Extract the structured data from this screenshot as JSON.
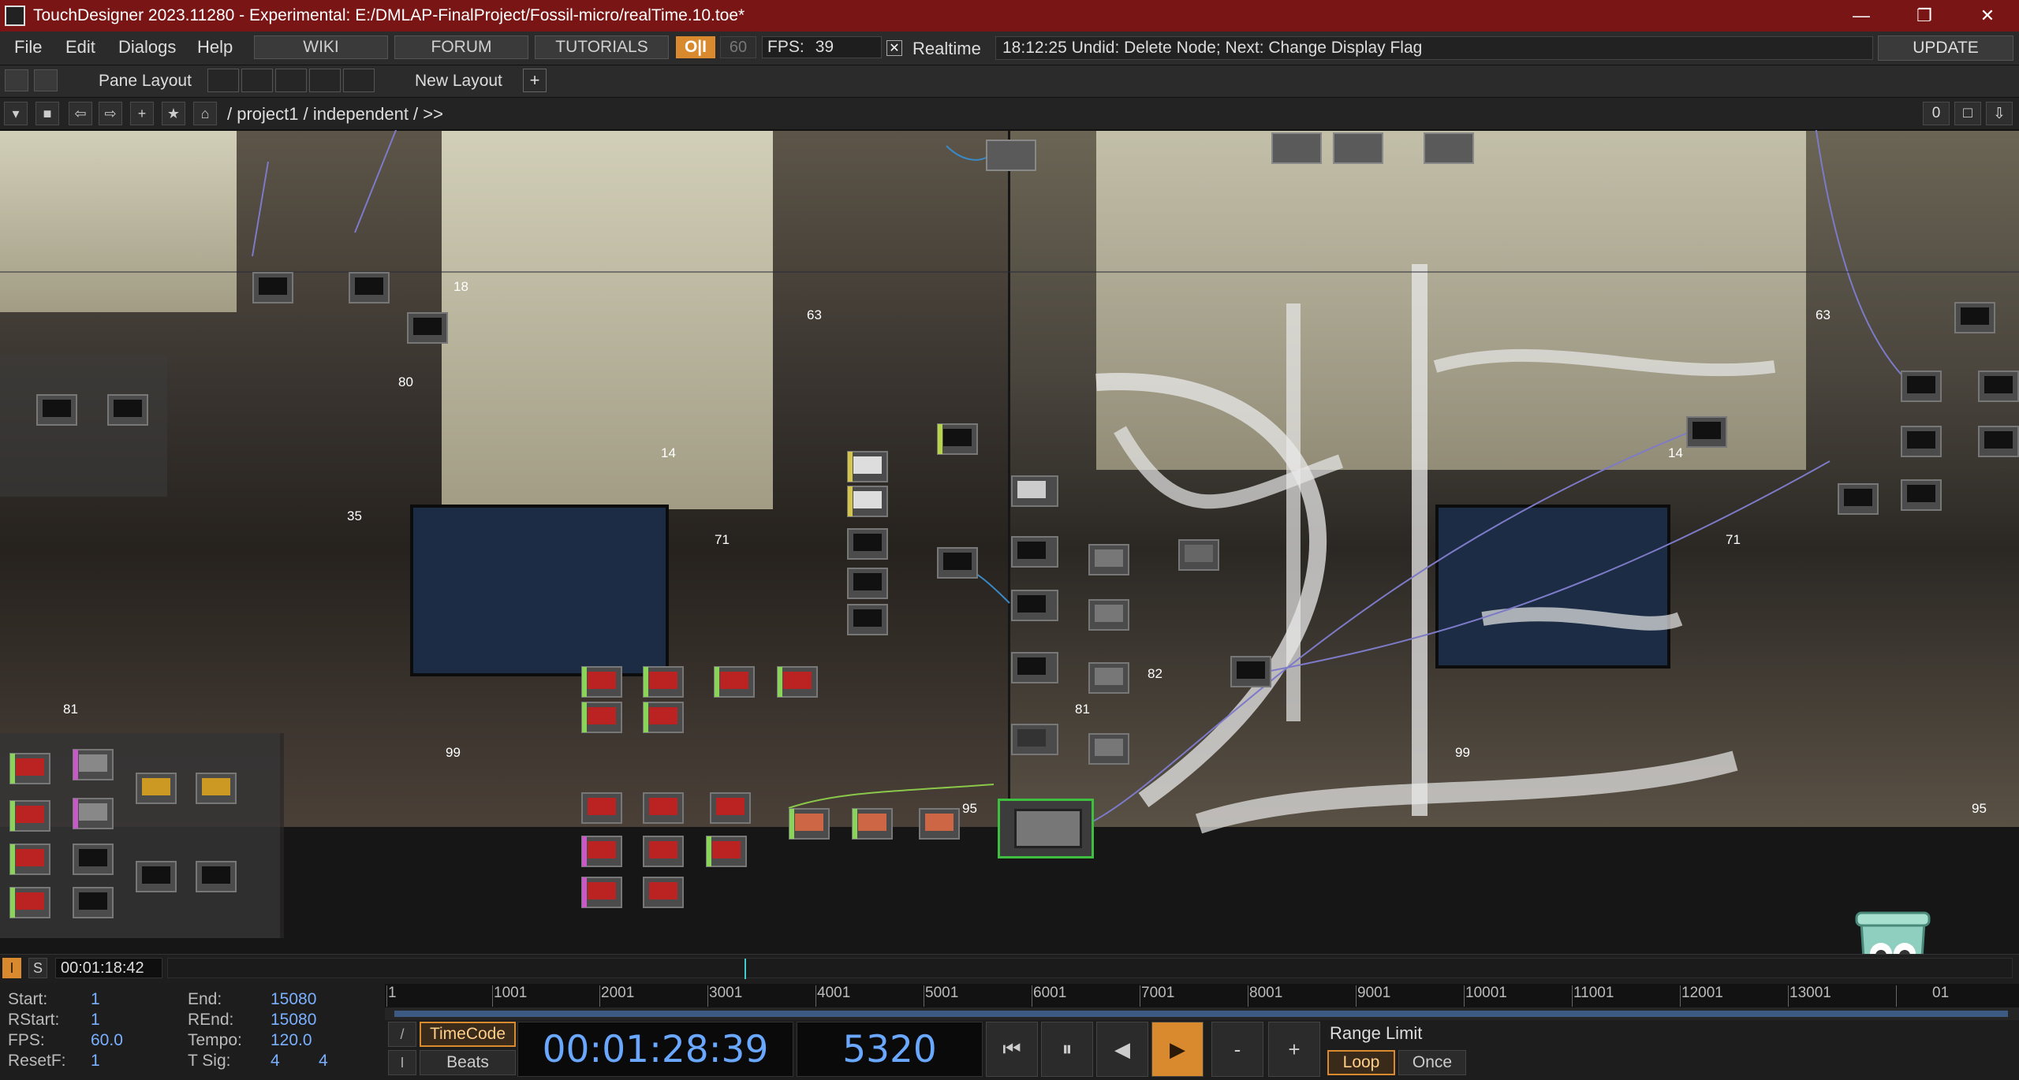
{
  "window": {
    "title": "TouchDesigner 2023.11280 - Experimental: E:/DMLAP-FinalProject/Fossil-micro/realTime.10.toe*",
    "minimize": "—",
    "restore": "❐",
    "close": "✕"
  },
  "menu": {
    "file": "File",
    "edit": "Edit",
    "dialogs": "Dialogs",
    "help": "Help",
    "wiki": "WIKI",
    "forum": "FORUM",
    "tutorials": "TUTORIALS",
    "oi": "O|I",
    "fps_limit": "60",
    "fps_label": "FPS:",
    "fps_value": "39",
    "realtime_check": "✕",
    "realtime": "Realtime",
    "status": "18:12:25 Undid: Delete Node; Next: Change Display Flag",
    "update": "UPDATE"
  },
  "layout_bar": {
    "pane_layout": "Pane Layout",
    "new_layout": "New Layout",
    "plus": "+"
  },
  "path_bar": {
    "path": "/ project1 / independent / >>",
    "counter": "0"
  },
  "network": {
    "node_numbers": [
      "18",
      "63",
      "80",
      "14",
      "35",
      "71",
      "81",
      "99",
      "95",
      "63",
      "14",
      "71",
      "95",
      "82",
      "81",
      "99"
    ]
  },
  "timeline": {
    "i_label": "I",
    "s_label": "S",
    "current_time": "00:01:18:42"
  },
  "info": {
    "start_label": "Start:",
    "start_value": "1",
    "rstart_label": "RStart:",
    "rstart_value": "1",
    "fps_label": "FPS:",
    "fps_value": "60.0",
    "resetf_label": "ResetF:",
    "resetf_value": "1",
    "end_label": "End:",
    "end_value": "15080",
    "rend_label": "REnd:",
    "rend_value": "15080",
    "tempo_label": "Tempo:",
    "tempo_value": "120.0",
    "tsig_label": "T Sig:",
    "tsig_value_1": "4",
    "tsig_value_2": "4"
  },
  "ruler": {
    "ticks": [
      "1",
      "1001",
      "2001",
      "3001",
      "4001",
      "5001",
      "6001",
      "7001",
      "8001",
      "9001",
      "10001",
      "11001",
      "12001",
      "13001",
      "01"
    ]
  },
  "transport": {
    "slash_btn": "/",
    "i_btn": "I",
    "timecode": "TimeCode",
    "beats": "Beats",
    "time_display": "00:01:28:39",
    "frame_display": "5320",
    "rewind": "⏮",
    "pause": "⏸",
    "step_back": "◀",
    "play": "▶",
    "minus": "-",
    "plus": "+",
    "range_limit": "Range Limit",
    "loop": "Loop",
    "once": "Once"
  },
  "colors": {
    "titlebar": "#7a1515",
    "accent": "#d98a2e",
    "selected": "#3fbf3f",
    "time_text": "#6aa8ff"
  }
}
